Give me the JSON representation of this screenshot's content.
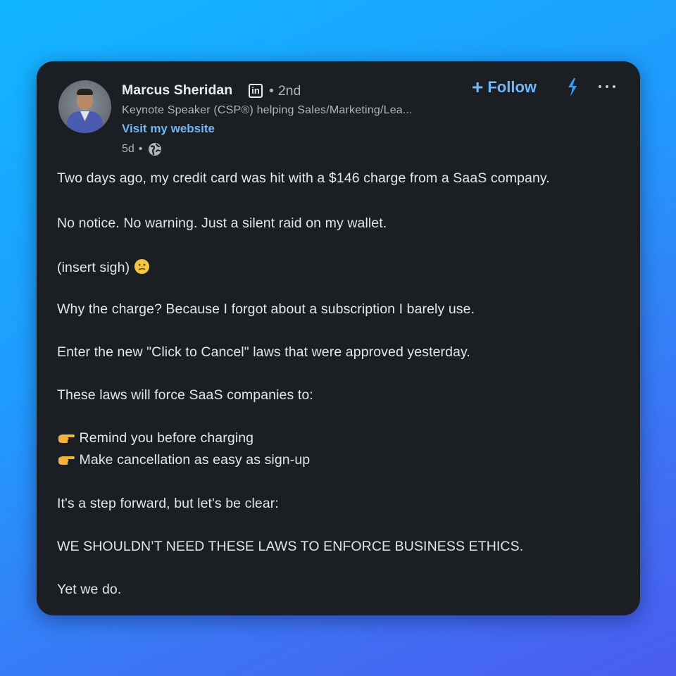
{
  "author": {
    "name": "Marcus Sheridan",
    "network_badge": "in",
    "degree": "2nd",
    "headline": "Keynote Speaker (CSP®) helping Sales/Marketing/Lea...",
    "website_label": "Visit my website",
    "time_ago": "5d"
  },
  "actions": {
    "follow_label": "Follow",
    "plus_glyph": "+"
  },
  "icons": {
    "linkedin": "linkedin-icon",
    "globe": "globe-icon",
    "bolt": "lightning-bolt-icon",
    "more": "more-options-icon",
    "sigh": "confused-face-emoji",
    "point": "pointing-right-emoji"
  },
  "colors": {
    "link": "#71b7fb",
    "card": "#1b1f23",
    "text": "#e4e6e8",
    "muted": "#b0b5ba"
  },
  "post": {
    "line1": "Two days ago, my credit card was hit with a $146 charge from a SaaS company.",
    "line2": "No notice. No warning. Just a silent raid on my wallet.",
    "line3": "(insert sigh)",
    "line4": "Why the charge? Because I forgot about a subscription I barely use.",
    "line5": "Enter the new \"Click to Cancel\" laws that were approved yesterday.",
    "line6": "These laws will force SaaS companies to:",
    "bullet1": "Remind you before charging",
    "bullet2": "Make cancellation as easy as sign-up",
    "line7": "It's a step forward, but let's be clear:",
    "line8": "WE SHOULDN’T NEED THESE LAWS TO ENFORCE BUSINESS ETHICS.",
    "line9": "Yet we do."
  }
}
